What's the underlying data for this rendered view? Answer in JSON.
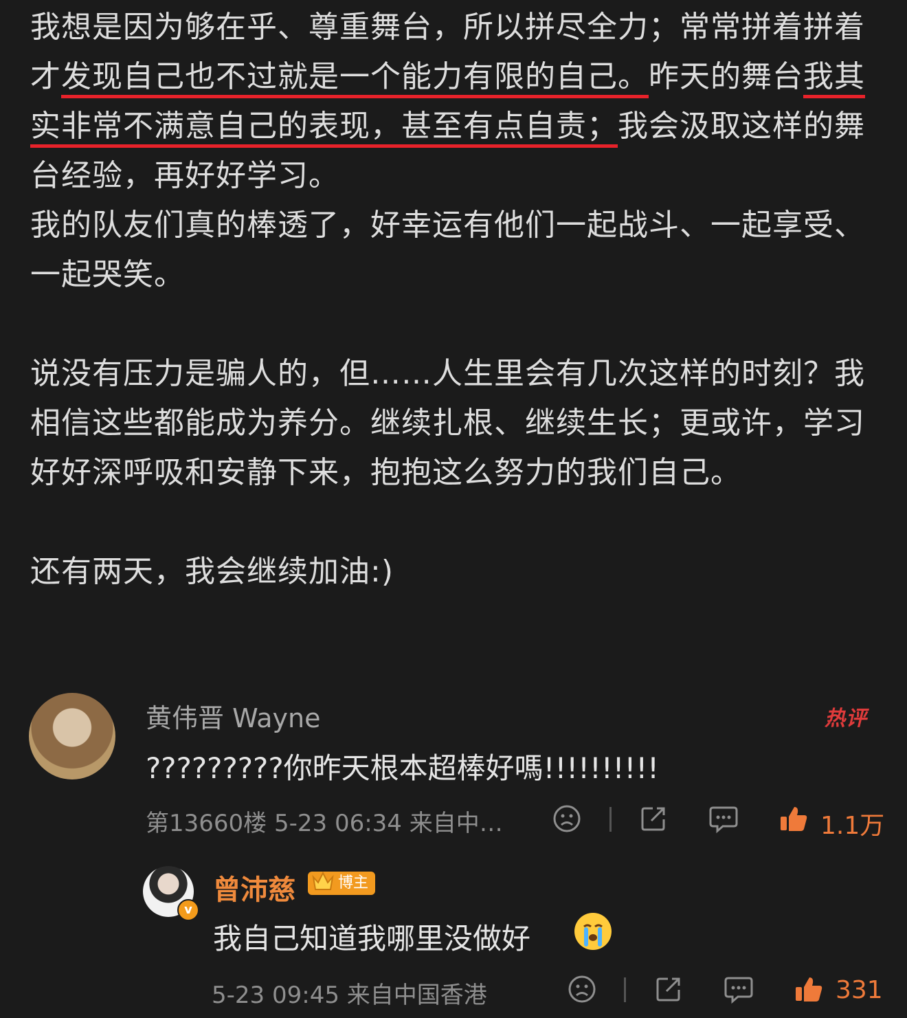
{
  "post": {
    "paragraph1": {
      "plain1": "我想是因为够在乎、尊重舞台，所以拼尽全力；常常拼着拼着才",
      "hl1": "发现自己也不过就是一个能力有限的自己。",
      "plain2": "昨天的舞台",
      "hl2": "我其实非常不满意自己的表现，",
      "hl3": "甚至有点自责；",
      "plain3": "我会汲取这样的舞台经验，再好好学习。"
    },
    "paragraph2": "我的队友们真的棒透了，好幸运有他们一起战斗、一起享受、一起哭笑。",
    "paragraph3": "说没有压力是骗人的，但……人生里会有几次这样的时刻？我相信这些都能成为养分。继续扎根、继续生长；更或许，学习好好深呼吸和安静下来，抱抱这么努力的我们自己。",
    "paragraph4": "还有两天，我会继续加油:)"
  },
  "comment1": {
    "username": "黄伟晋 Wayne",
    "hot_tag": "热评",
    "text": "?????????你昨天根本超棒好嗎!!!!!!!!!!",
    "meta": "第13660楼 5-23 06:34 来自中…",
    "likes": "1.1万"
  },
  "reply1": {
    "username": "曾沛慈",
    "badge": "博主",
    "text": "我自己知道我哪里没做好",
    "meta": "5-23 09:45 来自中国香港",
    "likes": "331"
  },
  "icons": {
    "dislike": "frown-face-icon",
    "share": "share-icon",
    "comment": "comment-bubble-icon",
    "like": "thumbs-up-icon",
    "emoji": "crying-face-emoji"
  },
  "colors": {
    "background": "#1b1b1b",
    "underline": "#e8222a",
    "like_orange": "#ef7a3a",
    "author_orange": "#f08a3c"
  }
}
